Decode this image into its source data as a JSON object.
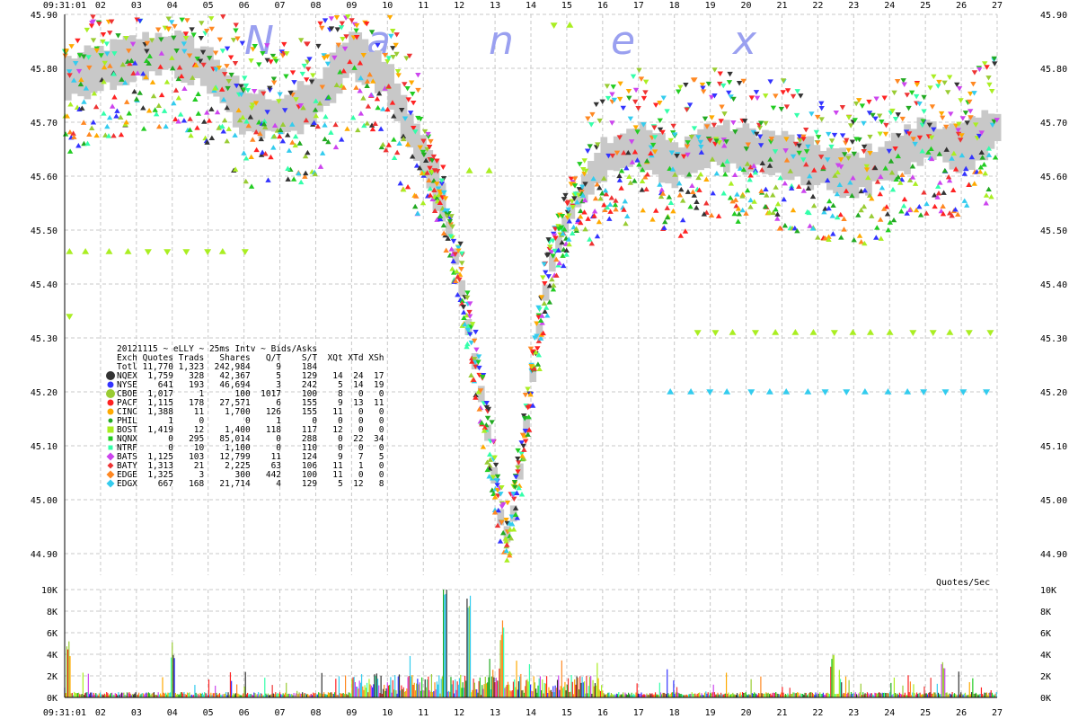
{
  "chart_data": [
    {
      "type": "scatter",
      "title": "20121115 ~ eLLY ~ 25ms Intv ~ Bids/Asks",
      "watermark": [
        "N",
        "a",
        "n",
        "e",
        "x"
      ],
      "x_tick_labels": [
        "09:31:01",
        "02",
        "03",
        "04",
        "05",
        "06",
        "07",
        "08",
        "09",
        "10",
        "11",
        "12",
        "13",
        "14",
        "15",
        "16",
        "17",
        "18",
        "19",
        "20",
        "21",
        "22",
        "23",
        "24",
        "25",
        "26",
        "27"
      ],
      "y_tick_labels": [
        "45.90",
        "45.80",
        "45.70",
        "45.60",
        "45.50",
        "45.40",
        "45.30",
        "45.20",
        "45.10",
        "45.00",
        "44.90"
      ],
      "ylim": [
        44.86,
        45.9
      ],
      "grid": true,
      "series_colors": {
        "NQEX": "#333333",
        "NYSE": "#3333ff",
        "CBOE": "#99cc33",
        "PACF": "#ff2222",
        "CINC": "#ffaa00",
        "PHIL": "#22aa22",
        "BOST": "#aaee22",
        "NQNX": "#22cc22",
        "NTRF": "#33ffaa",
        "BATS": "#cc44ee",
        "BATY": "#ee3333",
        "EDGE": "#ff8822",
        "EDGX": "#33ccee"
      },
      "nbbo_band_color": "#c8c8c8",
      "price_path": [
        [
          0.0,
          45.78
        ],
        [
          1.0,
          45.8
        ],
        [
          2.0,
          45.82
        ],
        [
          3.0,
          45.83
        ],
        [
          4.0,
          45.8
        ],
        [
          5.0,
          45.72
        ],
        [
          6.0,
          45.71
        ],
        [
          7.0,
          45.74
        ],
        [
          8.0,
          45.83
        ],
        [
          9.0,
          45.78
        ],
        [
          9.5,
          45.7
        ],
        [
          10.0,
          45.64
        ],
        [
          10.5,
          45.56
        ],
        [
          11.0,
          45.42
        ],
        [
          11.3,
          45.3
        ],
        [
          11.6,
          45.2
        ],
        [
          11.9,
          45.08
        ],
        [
          12.1,
          44.98
        ],
        [
          12.3,
          44.93
        ],
        [
          12.5,
          44.97
        ],
        [
          12.8,
          45.1
        ],
        [
          13.1,
          45.26
        ],
        [
          13.5,
          45.42
        ],
        [
          14.0,
          45.52
        ],
        [
          14.5,
          45.58
        ],
        [
          15.0,
          45.63
        ],
        [
          16.0,
          45.66
        ],
        [
          17.0,
          45.62
        ],
        [
          18.0,
          45.66
        ],
        [
          19.0,
          45.65
        ],
        [
          20.0,
          45.64
        ],
        [
          21.0,
          45.62
        ],
        [
          22.0,
          45.6
        ],
        [
          23.0,
          45.63
        ],
        [
          24.0,
          45.67
        ],
        [
          25.0,
          45.65
        ],
        [
          26.0,
          45.69
        ],
        [
          27.0,
          45.7
        ]
      ],
      "legend": {
        "header": "Exch Quotes Trads   Shares   Q/T    S/T  XQt XTd XSh",
        "total": "Totl 11,770 1,323  242,984     9    184",
        "rows": [
          {
            "exch": "NQEX",
            "text": "NQEX  1,759   328   42,367     5    129   14  24  17",
            "color": "#333333",
            "marker": "circle-lg"
          },
          {
            "exch": "NYSE",
            "text": "NYSE    641   193   46,694     3    242    5  14  19",
            "color": "#3333ff",
            "marker": "circle"
          },
          {
            "exch": "CBOE",
            "text": "CBOE  1,017     1      100  1017    100    8   0   0",
            "color": "#99cc33",
            "marker": "circle-lg"
          },
          {
            "exch": "PACF",
            "text": "PACF  1,115   178   27,571     6    155    9  13  11",
            "color": "#ff2222",
            "marker": "circle"
          },
          {
            "exch": "CINC",
            "text": "CINC  1,388    11    1,700   126    155   11   0   0",
            "color": "#ffaa00",
            "marker": "circle"
          },
          {
            "exch": "PHIL",
            "text": "PHIL      1     0        0     1      0    0   0   0",
            "color": "#22aa22",
            "marker": "circle-sm"
          },
          {
            "exch": "BOST",
            "text": "BOST  1,419    12    1,400   118    117   12   0   0",
            "color": "#aaee22",
            "marker": "square"
          },
          {
            "exch": "NQNX",
            "text": "NQNX      0   295   85,014     0    288    0  22  34",
            "color": "#22cc22",
            "marker": "square-sm"
          },
          {
            "exch": "NTRF",
            "text": "NTRF      0    10    1,100     0    110    0   0   0",
            "color": "#33ffaa",
            "marker": "square-sm"
          },
          {
            "exch": "BATS",
            "text": "BATS  1,125   103   12,799    11    124    9   7   5",
            "color": "#cc44ee",
            "marker": "diamond"
          },
          {
            "exch": "BATY",
            "text": "BATY  1,313    21    2,225    63    106   11   1   0",
            "color": "#ee3333",
            "marker": "diamond-sm"
          },
          {
            "exch": "EDGE",
            "text": "EDGE  1,325     3      300   442    100   11   0   0",
            "color": "#ff8822",
            "marker": "diamond"
          },
          {
            "exch": "EDGX",
            "text": "EDGX    667   168   21,714     4    129    5  12   8",
            "color": "#33ccee",
            "marker": "diamond"
          }
        ]
      }
    },
    {
      "type": "bar",
      "unit_label": "Quotes/Sec",
      "y_tick_labels": [
        "10K",
        "8K",
        "6K",
        "4K",
        "2K",
        "0K"
      ],
      "ylim": [
        0,
        10000
      ],
      "x_tick_labels": [
        "09:31:01",
        "02",
        "03",
        "04",
        "05",
        "06",
        "07",
        "08",
        "09",
        "10",
        "11",
        "12",
        "13",
        "14",
        "15",
        "16",
        "17",
        "18",
        "19",
        "20",
        "21",
        "22",
        "23",
        "24",
        "25",
        "26",
        "27"
      ],
      "peaks": [
        {
          "x": 0.1,
          "value": 5200
        },
        {
          "x": 3.0,
          "value": 5200
        },
        {
          "x": 10.6,
          "value": 10000
        },
        {
          "x": 11.25,
          "value": 9800
        },
        {
          "x": 12.2,
          "value": 6000
        },
        {
          "x": 21.4,
          "value": 4000
        },
        {
          "x": 24.5,
          "value": 3400
        },
        {
          "x": 26.2,
          "value": 2800
        }
      ]
    }
  ]
}
